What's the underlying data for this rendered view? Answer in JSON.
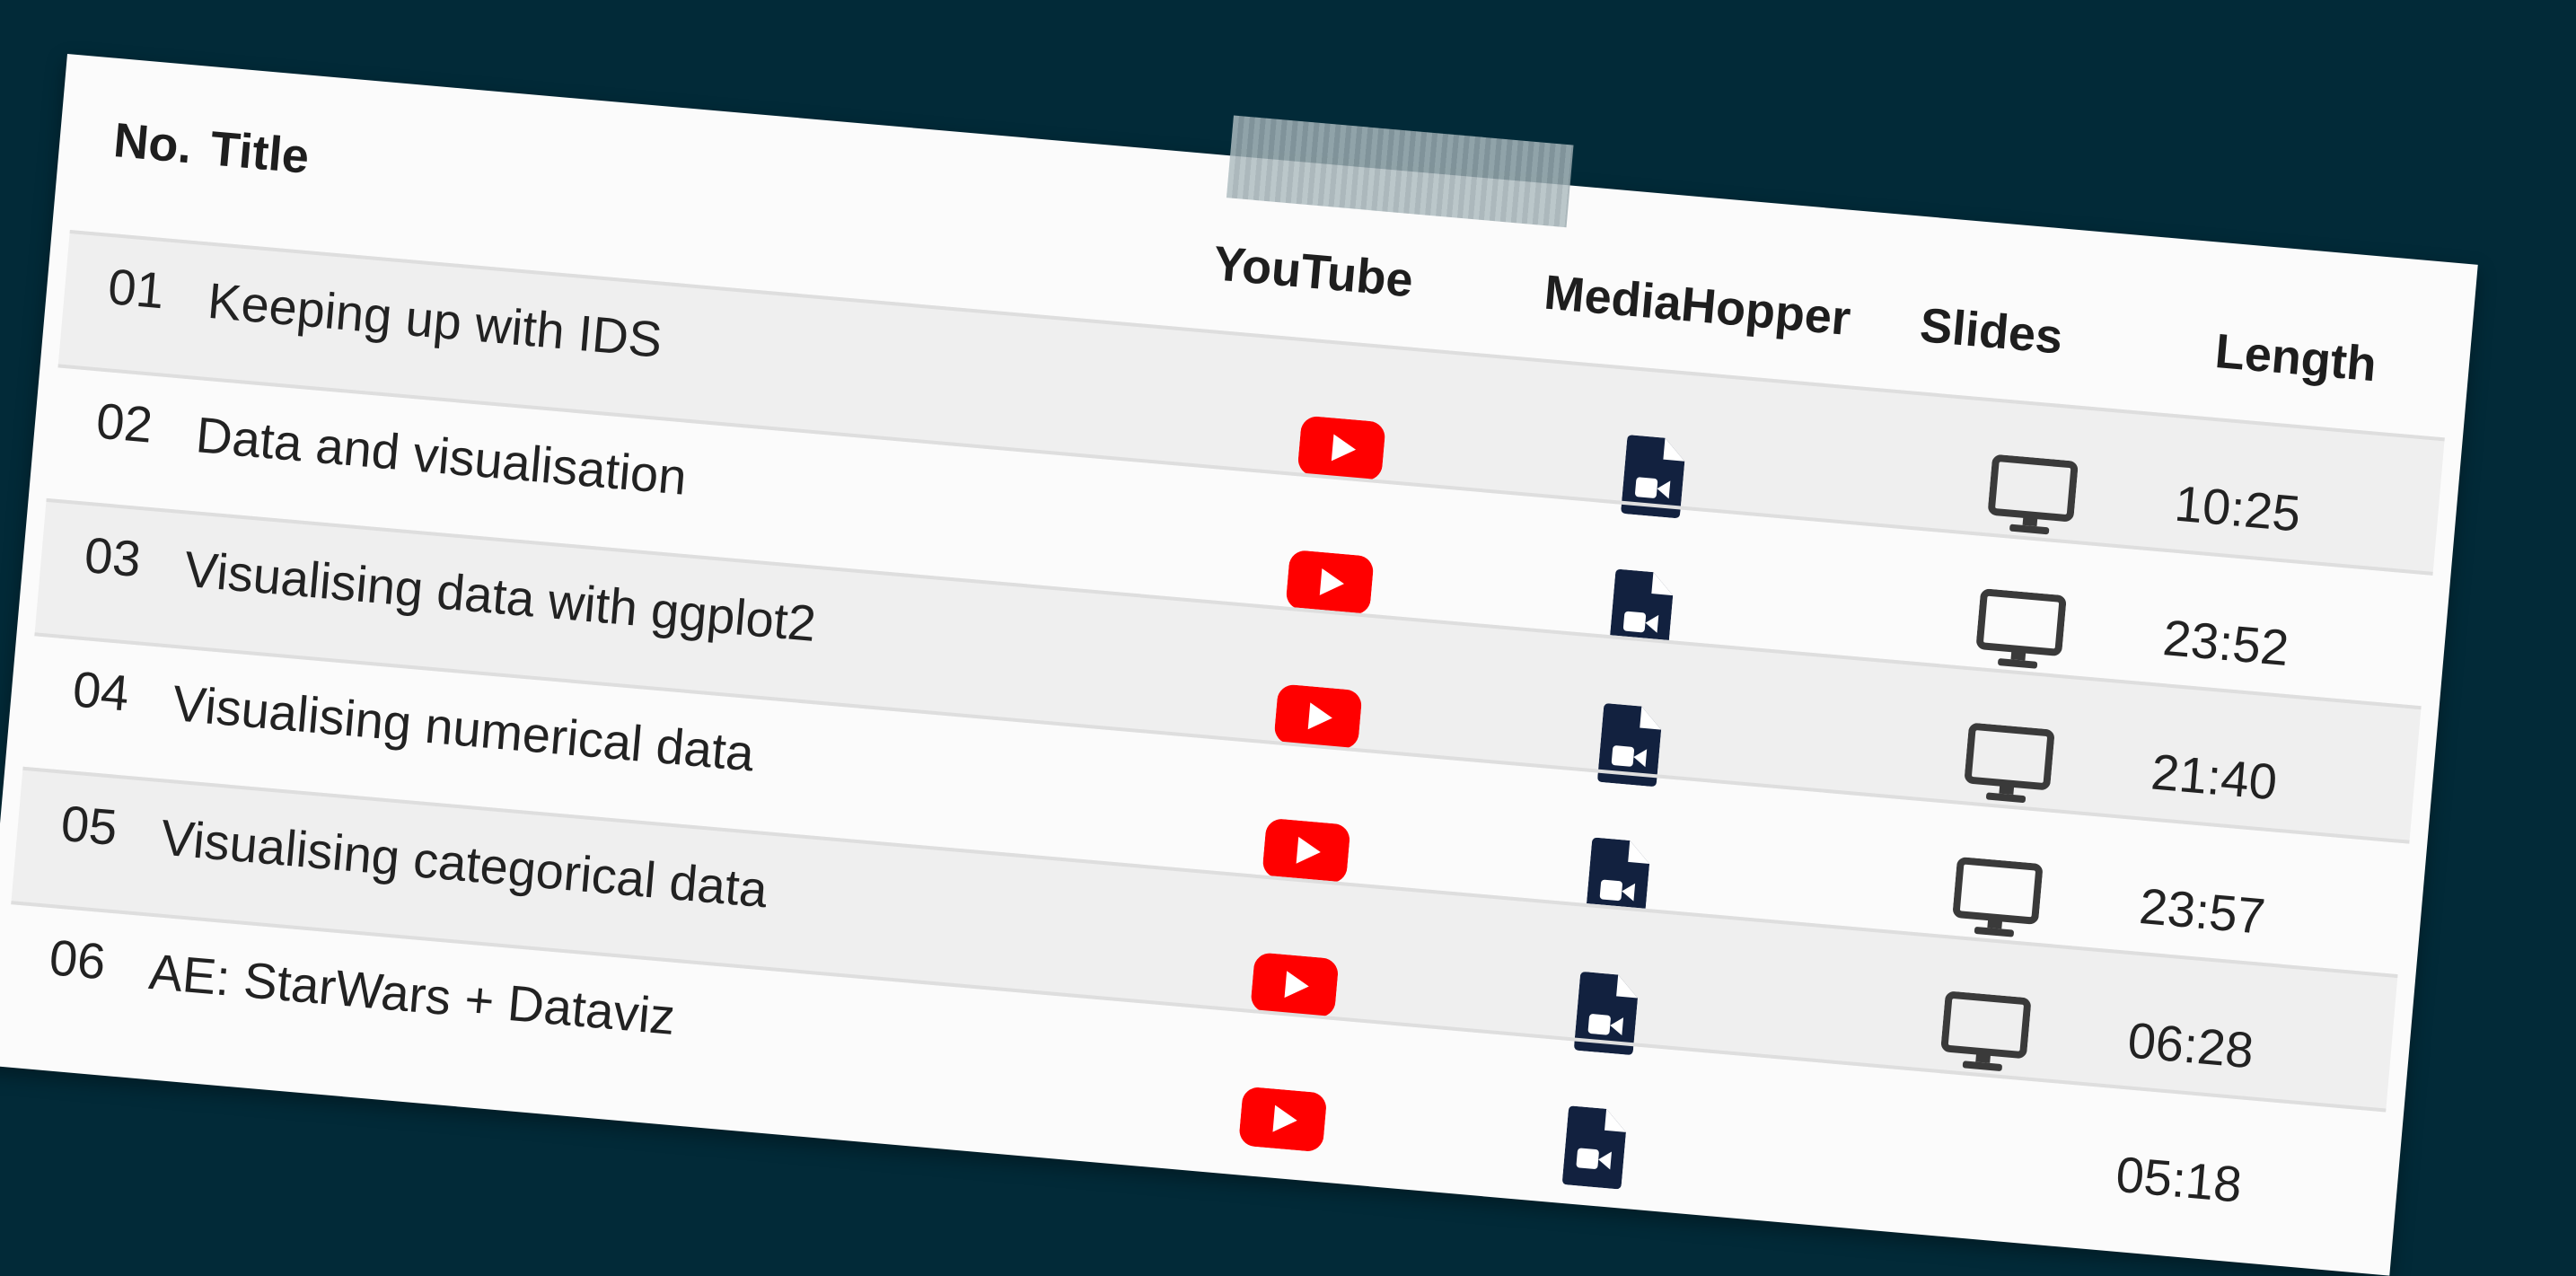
{
  "headers": {
    "no": "No.",
    "title": "Title",
    "youtube": "YouTube",
    "mediahopper": "MediaHopper",
    "slides": "Slides",
    "length": "Length"
  },
  "rows": [
    {
      "no": "01",
      "title": "Keeping up with IDS",
      "length": "10:25",
      "has_slides": true
    },
    {
      "no": "02",
      "title": "Data and visualisation",
      "length": "23:52",
      "has_slides": true
    },
    {
      "no": "03",
      "title": "Visualising data with ggplot2",
      "length": "21:40",
      "has_slides": true
    },
    {
      "no": "04",
      "title": "Visualising numerical data",
      "length": "23:57",
      "has_slides": true
    },
    {
      "no": "05",
      "title": "Visualising categorical data",
      "length": "06:28",
      "has_slides": true
    },
    {
      "no": "06",
      "title": "AE: StarWars + Dataviz",
      "length": "05:18",
      "has_slides": false
    }
  ],
  "icons": {
    "youtube": "youtube-icon",
    "mediahopper": "video-file-icon",
    "slides": "monitor-icon"
  },
  "colors": {
    "background": "#022a38",
    "card": "#fbfbfb",
    "stripe": "#efefef",
    "youtube_red": "#ff0000",
    "file_navy": "#12213f",
    "monitor_gray": "#3a3a3a"
  }
}
